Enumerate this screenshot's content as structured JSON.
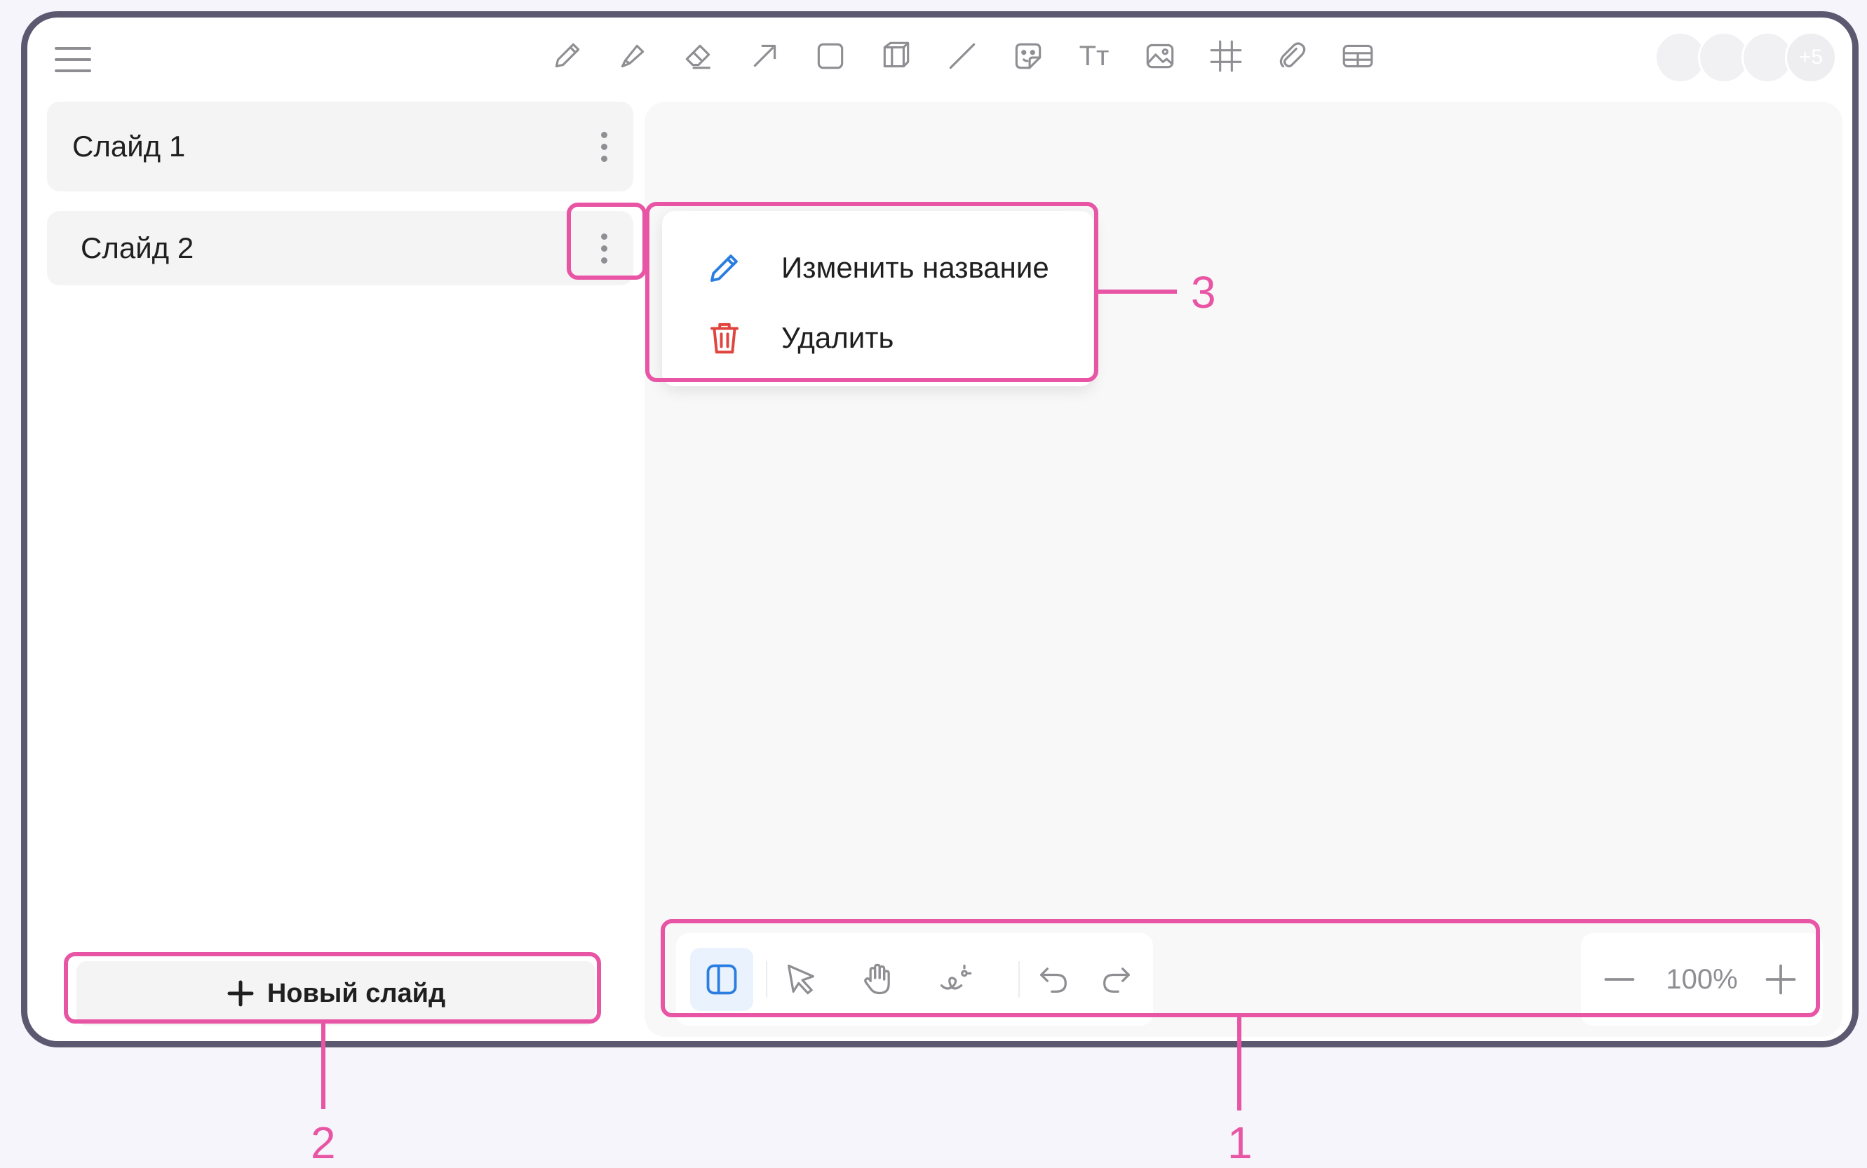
{
  "toolbar": {
    "tools": [
      {
        "icon": "pencil-icon"
      },
      {
        "icon": "marker-icon"
      },
      {
        "icon": "eraser-icon"
      },
      {
        "icon": "arrow-icon"
      },
      {
        "icon": "rectangle-icon"
      },
      {
        "icon": "cube-icon"
      },
      {
        "icon": "line-icon"
      },
      {
        "icon": "sticker-icon"
      },
      {
        "icon": "text-icon",
        "glyph": "Tт"
      },
      {
        "icon": "image-icon"
      },
      {
        "icon": "grid-icon"
      },
      {
        "icon": "attachment-icon"
      },
      {
        "icon": "table-icon"
      }
    ],
    "avatar_count": "+5"
  },
  "slides": {
    "items": [
      {
        "label": "Слайд 1"
      },
      {
        "label": "Слайд 2"
      }
    ],
    "new_slide_label": "Новый слайд"
  },
  "context_menu": {
    "items": [
      {
        "label": "Изменить название",
        "icon": "pencil-icon",
        "color": "#2a7de1"
      },
      {
        "label": "Удалить",
        "icon": "trash-icon",
        "color": "#e0443e"
      }
    ]
  },
  "bottom_toolbar": {
    "tools": [
      {
        "icon": "panel-toggle-icon"
      },
      {
        "icon": "pointer-icon"
      },
      {
        "icon": "hand-icon"
      },
      {
        "icon": "laser-pointer-icon"
      },
      {
        "icon": "undo-icon"
      },
      {
        "icon": "redo-icon"
      }
    ],
    "zoom_value": "100%"
  },
  "callouts": {
    "one": "1",
    "two": "2",
    "three": "3"
  },
  "colors": {
    "highlight": "#e855a5",
    "frame": "#5b5870",
    "accent": "#2a7de1",
    "danger": "#e0443e"
  }
}
